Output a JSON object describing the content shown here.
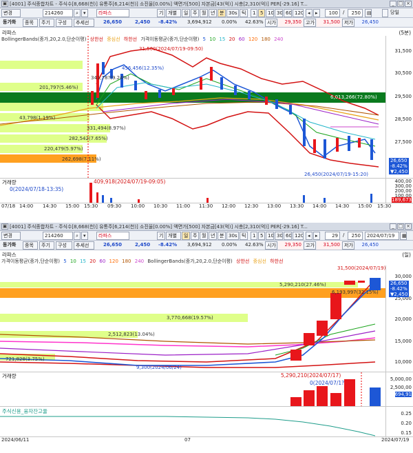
{
  "top": {
    "title": "[4001] 주식종합차트 - 주식수[8,668(천)] 유통주[6,214(천)] 소진율[0.00%] 액면가[500] 자본금[43(억)] 시총[2,310(억)] PER[-29.16] T...",
    "toolbar1": {
      "combo1": "변경",
      "code": "214260",
      "name": "라파스",
      "periods": [
        "기",
        "개별",
        "일",
        "주",
        "월",
        "년",
        "분",
        "30s",
        "틱"
      ],
      "minutes": [
        "1",
        "5",
        "10",
        "30",
        "60",
        "120"
      ],
      "count": "100",
      "total": "250",
      "dangil": "당일"
    },
    "toolbar2": {
      "tabs": [
        "동가화",
        "종목",
        "주기",
        "구성",
        "추세선"
      ],
      "price": "26,650",
      "change": "2,450",
      "pct": "-8.42%",
      "volume": "3,694,912",
      "rate": "0.00%",
      "rate2": "42.63%",
      "open_lbl": "시가",
      "open": "29,350",
      "high_lbl": "고가",
      "high": "31,500",
      "low_lbl": "저가",
      "low": "26,450"
    },
    "panel_name": "라파스",
    "period_tag": "(5분)",
    "legend": {
      "bb": "BollingerBands(종가,20,2.0,단순이평)",
      "bb_lines": [
        "상한선",
        "중심선",
        "하한선"
      ],
      "ma": "가격이동평균(종가,단순이평)",
      "ma_periods": [
        "5",
        "10",
        "15",
        "20",
        "60",
        "120",
        "180",
        "240"
      ]
    },
    "price_labels": [
      "31,500(2024/07/19-09:50)",
      "456,456(12.35%)",
      "341,78?(9.24%)",
      "201,797(5.46%)",
      "43,798(1.19%)",
      "331,494(8.97%)",
      "282,542(7.65%)",
      "220,479(5.97%)",
      "262,698(7.11%)",
      "6,013,266(72.80%)",
      "26,450(2024/07/19-15:20)"
    ],
    "y_ticks": [
      "31,500",
      "30,500",
      "29,500",
      "28,500",
      "27,500"
    ],
    "side_tags": [
      "26,650",
      "-8.42%",
      "▼2,450"
    ],
    "volume_title": "거래량",
    "volume_labels": [
      "0(2024/07/18-13:35)",
      "409,918(2024/07/19-09:05)"
    ],
    "vol_ticks": [
      "400,00",
      "300,00",
      "200,00",
      "100,00",
      "189,673"
    ],
    "x_ticks": [
      "07/18",
      "14:00",
      "14:30",
      "15:00",
      "15:30",
      "09:30",
      "10:00",
      "10:30",
      "11:00",
      "11:30",
      "12:00",
      "12:30",
      "13:00",
      "13:30",
      "14:00",
      "14:30",
      "15:00",
      "15:30"
    ]
  },
  "bottom": {
    "title": "[4001] 주식종합차트 - 주식수[8,668(천)] 유통주[6,214(천)] 소진율[0.00%] 액면가[500] 자본금[43(억)] 시총[2,310(억)] PER[-29.16] T...",
    "toolbar1": {
      "combo1": "변경",
      "code": "214260",
      "name": "라파스",
      "periods": [
        "기",
        "개별",
        "일",
        "주",
        "월",
        "년",
        "분",
        "30s",
        "틱"
      ],
      "minutes": [
        "1",
        "5",
        "10",
        "30",
        "60",
        "120"
      ],
      "count": "29",
      "total": "250",
      "date": "2024/07/19"
    },
    "toolbar2": {
      "tabs": [
        "동가화",
        "종목",
        "주기",
        "구성",
        "추세선"
      ],
      "price": "26,650",
      "change": "2,450",
      "pct": "-8.42%",
      "volume": "3,694,912",
      "rate": "0.00%",
      "rate2": "42.63%",
      "open_lbl": "시가",
      "open": "29,350",
      "high_lbl": "고가",
      "high": "31,500",
      "low_lbl": "저가",
      "low": "26,450"
    },
    "panel_name": "라파스",
    "period_tag": "(일)",
    "legend": {
      "ma": "가격이동평균(종가,단순이평)",
      "ma_periods": [
        "5",
        "10",
        "15",
        "20",
        "60",
        "120",
        "180",
        "240"
      ],
      "bb": "BollingerBands(종가,20,2.0,단순이평)",
      "bb_lines": [
        "상한선",
        "중심선",
        "하한선"
      ]
    },
    "price_labels": [
      "31,500(2024/07/19)",
      "5,290,210(27.46%)",
      "6,193,997(32.15%)",
      "3,770,668(19.57%)",
      "2,512,823(13.04%)",
      "721,828(3.75%)",
      "9,300(2024/06/24)"
    ],
    "y_ticks": [
      "30,000",
      "25,000",
      "20,000",
      "15,000",
      "10,000"
    ],
    "side_tags": [
      "26,650",
      "-8.42%",
      "▼2,450"
    ],
    "volume_title": "거래량",
    "volume_labels": [
      "5,290,210(2024/07/17)",
      "0(2024/07/1?)"
    ],
    "vol_ticks": [
      "5,000,00",
      "2,500,00",
      "694,91"
    ],
    "credit_title": "주식신용_융자잔고율",
    "credit_ticks": [
      "0.25",
      "0.20",
      "0.15"
    ],
    "x_ticks": [
      "2024/06/11",
      "07",
      "2024/07/19"
    ]
  },
  "colors": {
    "up": "#e8161b",
    "down": "#1d57d6",
    "bb_upper": "#d31212",
    "bb_mid": "#e9a31b",
    "bb_lower": "#d31212",
    "green_band": "#0a7a1e",
    "yellow_band": "#dfff8a",
    "orange_band": "#ffa020"
  }
}
